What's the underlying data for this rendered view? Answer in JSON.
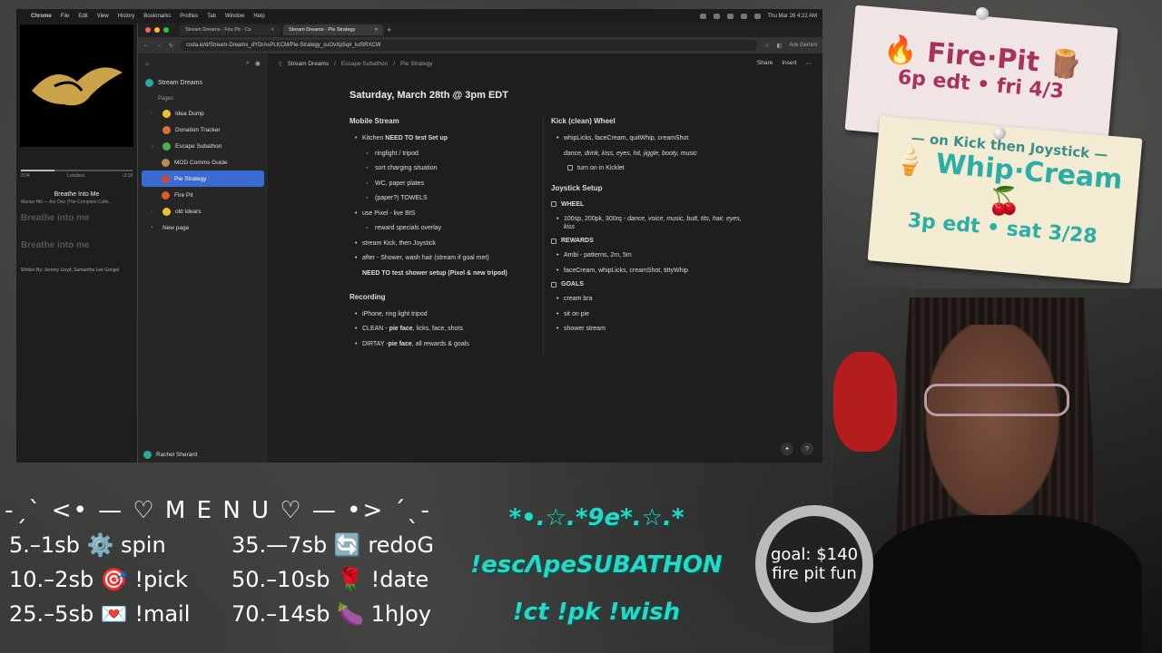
{
  "menubar": {
    "app": "Chrome",
    "items": [
      "File",
      "Edit",
      "View",
      "History",
      "Bookmarks",
      "Profiles",
      "Tab",
      "Window",
      "Help"
    ],
    "datetime": "Thu Mar 26  4:22 AM"
  },
  "music": {
    "elapsed": "3:24",
    "quality": "Lossless",
    "remaining": "-3:18",
    "song": "Breathe Into Me",
    "artist": "Marian Hill — Act One (The Complete Colle...",
    "lyric1": "Breathe into me",
    "lyric2": "Breathe into me",
    "credit": "Written By: Jeremy Lloyd, Samantha Lee Gongol"
  },
  "browser": {
    "tab1": "Stream Dreams - Fire Pit - Co",
    "tab2": "Stream Dreams - Pie Strategy",
    "url": "coda.io/d/Stream-Dreams_dYDrAsPLKCM/Pie-Strategy_suOvXp5q#_lutSRXCW",
    "gemini": "Ask Gemini"
  },
  "sidebar": {
    "doc": "Stream Dreams",
    "pages_label": "Pages",
    "items": [
      "Idea Dump",
      "Donation Tracker",
      "Escape Subathon",
      "MOD Comms Guide",
      "Pie Strategy",
      "Fire Pit",
      "old Idears"
    ],
    "new_page": "New page",
    "user": "Rachel Sherard"
  },
  "breadcrumb": [
    "Stream Dreams",
    "Escape Subathon",
    "Pie Strategy"
  ],
  "actions": {
    "share": "Share",
    "insert": "Insert"
  },
  "doc": {
    "title": "Saturday, March 28th @ 3pm EDT",
    "mobile": {
      "heading": "Mobile Stream",
      "kitchen_pre": "Kitchen ",
      "kitchen_bold": "NEED TO test Set up",
      "sub1": [
        "ringlight / tripod",
        "sort charging situation",
        "WC, paper plates",
        "(paper?) TOWELS"
      ],
      "pixel": "use Pixel - live BtS",
      "sub2": "reward specials overlay",
      "kick": "stream Kick, then Joystick",
      "after": "after - Shower, wash hair (stream if goal met)",
      "shower": "NEED TO test shower setup (Pixel & new tripod)"
    },
    "recording": {
      "heading": "Recording",
      "r1": "iPhone, ring light tripod",
      "r2_pre": "CLEAN - ",
      "r2_bold": "pie face",
      "r2_post": ", licks, face, shots",
      "r3_pre": "DIRTAY -",
      "r3_bold": "pie face",
      "r3_post": ",  all rewards & goals"
    },
    "kick": {
      "heading": "Kick (clean) Wheel",
      "line": "whipLicks, faceCream, quitWhip, creamShot",
      "italic": "dance, drink, kiss, eyes, hit, jiggle, booty, music",
      "check": "turn on in  Kicklet"
    },
    "joystick": {
      "heading": "Joystick Setup",
      "wheel": "WHEEL",
      "wheel_pre": "100sp, 200pk, 300rq - ",
      "wheel_it": "dance, voice, music, butt, tits, hair, eyes, kiss",
      "rewards": "REWARDS",
      "rw1": "Ambi - patterns, 2m, 5m",
      "rw2": "faceCream, whipLicks, creamShot, tittyWhip",
      "goals": "GOALS",
      "g": [
        "cream bra",
        "sit on pie",
        "shower stream"
      ]
    }
  },
  "sign1": {
    "line1": "🔥 Fire·Pit 🪵",
    "line2": "6p edt • fri 4/3"
  },
  "sign2": {
    "line1": "— on Kick then Joystick —",
    "line2": "🍦 Whip·Cream 🍒",
    "line3": "3p edt • sat 3/28"
  },
  "menu": {
    "title": "-ˏˋ <• — ♡ M E N U ♡ — •> ˊˎ-",
    "left": [
      "5.–1sb ⚙️ spin",
      "10.–2sb 🎯 !pick",
      "25.–5sb 💌 !mail"
    ],
    "right": [
      "35.—7sb 🔄 redoG",
      "50.–10sb 🌹 !date",
      "70.–14sb 🍆 1hJoy"
    ]
  },
  "teal": {
    "l1": "*•.☆.*9e*.☆.*",
    "l2": "!escΛpeSUBATHON",
    "l3": "!ct  !pk  !wish"
  },
  "goal": {
    "l1": "goal: $140",
    "l2": "fire pit fun"
  },
  "colors": {
    "accent": "#3a6bd1",
    "teal": "#25d9c8",
    "pink": "#a8325a"
  }
}
